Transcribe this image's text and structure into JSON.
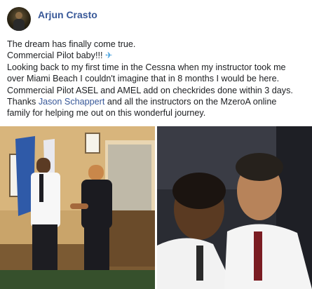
{
  "post": {
    "author": "Arjun Crasto",
    "text_lines": [
      "The dream has finally come true.",
      "Commercial Pilot baby!!!",
      "Looking back to my first time in the Cessna when my instructor took me",
      "over Miami Beach I couldn't imagine that in 8 months I would be here.",
      "Commercial Pilot ASEL and AMEL add on checkrides done within 3 days."
    ],
    "line6_before": "Thanks ",
    "mention": "Jason Schappert",
    "line6_after": " and all the instructors on the MzeroA online",
    "line7": "family for helping me out on this wonderful journey.",
    "emoji_icon": "airplane-icon",
    "emoji_glyph": "✈"
  },
  "colors": {
    "author": "#385898",
    "link": "#385898",
    "text": "#1c1e21"
  }
}
